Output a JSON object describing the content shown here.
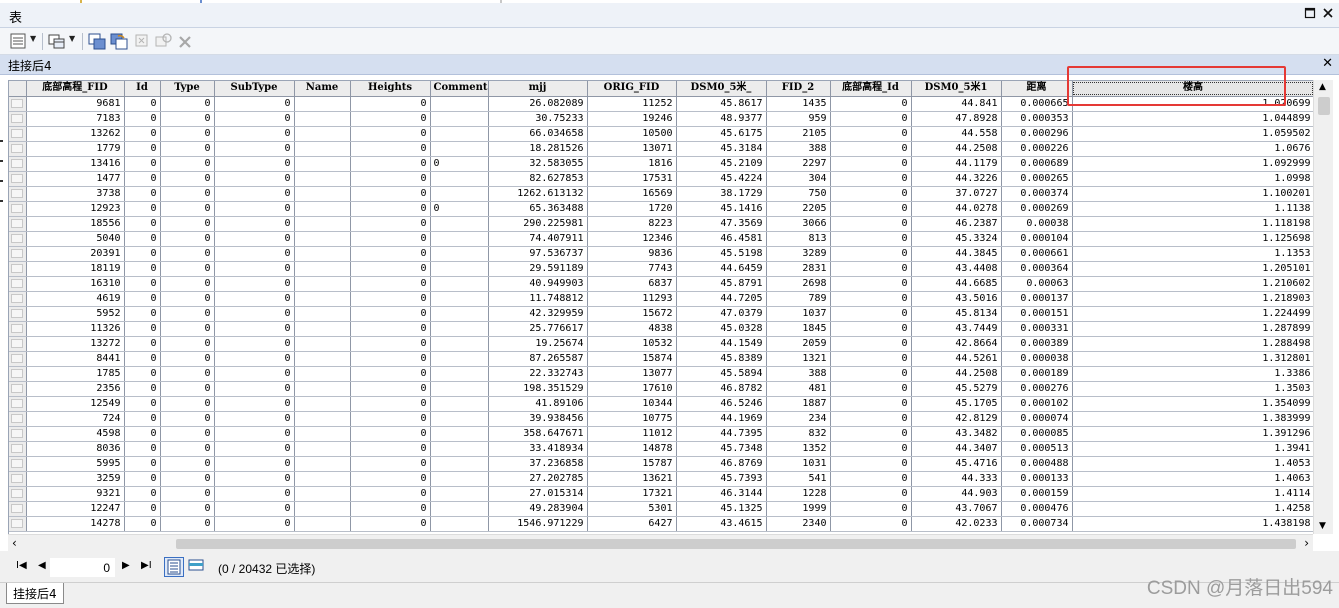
{
  "window": {
    "title": "表"
  },
  "table_tab": {
    "title": "挂接后4"
  },
  "columns": [
    "底部高程_FID",
    "Id",
    "Type",
    "SubType",
    "Name",
    "Heights",
    "Comment",
    "mjj",
    "ORIG_FID",
    "DSM0_5米_",
    "FID_2",
    "底部高程_Id",
    "DSM0_5米1",
    "距离",
    "楼高"
  ],
  "rows": [
    [
      "9681",
      "0",
      "0",
      "0",
      "",
      "0",
      "",
      "26.082089",
      "11252",
      "45.8617",
      "1435",
      "0",
      "44.841",
      "0.000665",
      "1.020699"
    ],
    [
      "7183",
      "0",
      "0",
      "0",
      "",
      "0",
      "",
      "30.75233",
      "19246",
      "48.9377",
      "959",
      "0",
      "47.8928",
      "0.000353",
      "1.044899"
    ],
    [
      "13262",
      "0",
      "0",
      "0",
      "",
      "0",
      "",
      "66.034658",
      "10500",
      "45.6175",
      "2105",
      "0",
      "44.558",
      "0.000296",
      "1.059502"
    ],
    [
      "1779",
      "0",
      "0",
      "0",
      "",
      "0",
      "",
      "18.281526",
      "13071",
      "45.3184",
      "388",
      "0",
      "44.2508",
      "0.000226",
      "1.0676"
    ],
    [
      "13416",
      "0",
      "0",
      "0",
      "",
      "0",
      "0",
      "32.583055",
      "1816",
      "45.2109",
      "2297",
      "0",
      "44.1179",
      "0.000689",
      "1.092999"
    ],
    [
      "1477",
      "0",
      "0",
      "0",
      "",
      "0",
      "",
      "82.627853",
      "17531",
      "45.4224",
      "304",
      "0",
      "44.3226",
      "0.000265",
      "1.0998"
    ],
    [
      "3738",
      "0",
      "0",
      "0",
      "",
      "0",
      "",
      "1262.613132",
      "16569",
      "38.1729",
      "750",
      "0",
      "37.0727",
      "0.000374",
      "1.100201"
    ],
    [
      "12923",
      "0",
      "0",
      "0",
      "",
      "0",
      "0",
      "65.363488",
      "1720",
      "45.1416",
      "2205",
      "0",
      "44.0278",
      "0.000269",
      "1.1138"
    ],
    [
      "18556",
      "0",
      "0",
      "0",
      "",
      "0",
      "",
      "290.225981",
      "8223",
      "47.3569",
      "3066",
      "0",
      "46.2387",
      "0.00038",
      "1.118198"
    ],
    [
      "5040",
      "0",
      "0",
      "0",
      "",
      "0",
      "",
      "74.407911",
      "12346",
      "46.4581",
      "813",
      "0",
      "45.3324",
      "0.000104",
      "1.125698"
    ],
    [
      "20391",
      "0",
      "0",
      "0",
      "",
      "0",
      "",
      "97.536737",
      "9836",
      "45.5198",
      "3289",
      "0",
      "44.3845",
      "0.000661",
      "1.1353"
    ],
    [
      "18119",
      "0",
      "0",
      "0",
      "",
      "0",
      "",
      "29.591189",
      "7743",
      "44.6459",
      "2831",
      "0",
      "43.4408",
      "0.000364",
      "1.205101"
    ],
    [
      "16310",
      "0",
      "0",
      "0",
      "",
      "0",
      "",
      "40.949903",
      "6837",
      "45.8791",
      "2698",
      "0",
      "44.6685",
      "0.00063",
      "1.210602"
    ],
    [
      "4619",
      "0",
      "0",
      "0",
      "",
      "0",
      "",
      "11.748812",
      "11293",
      "44.7205",
      "789",
      "0",
      "43.5016",
      "0.000137",
      "1.218903"
    ],
    [
      "5952",
      "0",
      "0",
      "0",
      "",
      "0",
      "",
      "42.329959",
      "15672",
      "47.0379",
      "1037",
      "0",
      "45.8134",
      "0.000151",
      "1.224499"
    ],
    [
      "11326",
      "0",
      "0",
      "0",
      "",
      "0",
      "",
      "25.776617",
      "4838",
      "45.0328",
      "1845",
      "0",
      "43.7449",
      "0.000331",
      "1.287899"
    ],
    [
      "13272",
      "0",
      "0",
      "0",
      "",
      "0",
      "",
      "19.25674",
      "10532",
      "44.1549",
      "2059",
      "0",
      "42.8664",
      "0.000389",
      "1.288498"
    ],
    [
      "8441",
      "0",
      "0",
      "0",
      "",
      "0",
      "",
      "87.265587",
      "15874",
      "45.8389",
      "1321",
      "0",
      "44.5261",
      "0.000038",
      "1.312801"
    ],
    [
      "1785",
      "0",
      "0",
      "0",
      "",
      "0",
      "",
      "22.332743",
      "13077",
      "45.5894",
      "388",
      "0",
      "44.2508",
      "0.000189",
      "1.3386"
    ],
    [
      "2356",
      "0",
      "0",
      "0",
      "",
      "0",
      "",
      "198.351529",
      "17610",
      "46.8782",
      "481",
      "0",
      "45.5279",
      "0.000276",
      "1.3503"
    ],
    [
      "12549",
      "0",
      "0",
      "0",
      "",
      "0",
      "",
      "41.89106",
      "10344",
      "46.5246",
      "1887",
      "0",
      "45.1705",
      "0.000102",
      "1.354099"
    ],
    [
      "724",
      "0",
      "0",
      "0",
      "",
      "0",
      "",
      "39.938456",
      "10775",
      "44.1969",
      "234",
      "0",
      "42.8129",
      "0.000074",
      "1.383999"
    ],
    [
      "4598",
      "0",
      "0",
      "0",
      "",
      "0",
      "",
      "358.647671",
      "11012",
      "44.7395",
      "832",
      "0",
      "43.3482",
      "0.000085",
      "1.391296"
    ],
    [
      "8036",
      "0",
      "0",
      "0",
      "",
      "0",
      "",
      "33.418934",
      "14878",
      "45.7348",
      "1352",
      "0",
      "44.3407",
      "0.000513",
      "1.3941"
    ],
    [
      "5995",
      "0",
      "0",
      "0",
      "",
      "0",
      "",
      "37.236858",
      "15787",
      "46.8769",
      "1031",
      "0",
      "45.4716",
      "0.000488",
      "1.4053"
    ],
    [
      "3259",
      "0",
      "0",
      "0",
      "",
      "0",
      "",
      "27.202785",
      "13621",
      "45.7393",
      "541",
      "0",
      "44.333",
      "0.000133",
      "1.4063"
    ],
    [
      "9321",
      "0",
      "0",
      "0",
      "",
      "0",
      "",
      "27.015314",
      "17321",
      "46.3144",
      "1228",
      "0",
      "44.903",
      "0.000159",
      "1.4114"
    ],
    [
      "12247",
      "0",
      "0",
      "0",
      "",
      "0",
      "",
      "49.283904",
      "5301",
      "45.1325",
      "1999",
      "0",
      "43.7067",
      "0.000476",
      "1.4258"
    ],
    [
      "14278",
      "0",
      "0",
      "0",
      "",
      "0",
      "",
      "1546.971229",
      "6427",
      "43.4615",
      "2340",
      "0",
      "42.0233",
      "0.000734",
      "1.438198"
    ]
  ],
  "navigation": {
    "current_record": "0",
    "status": "(0 / 20432 已选择)"
  },
  "bottom_tab": "挂接后4",
  "watermark": "CSDN @月落日出594",
  "colors": {
    "annotation": "#e53935",
    "tab_strip": "#d5dff0"
  }
}
